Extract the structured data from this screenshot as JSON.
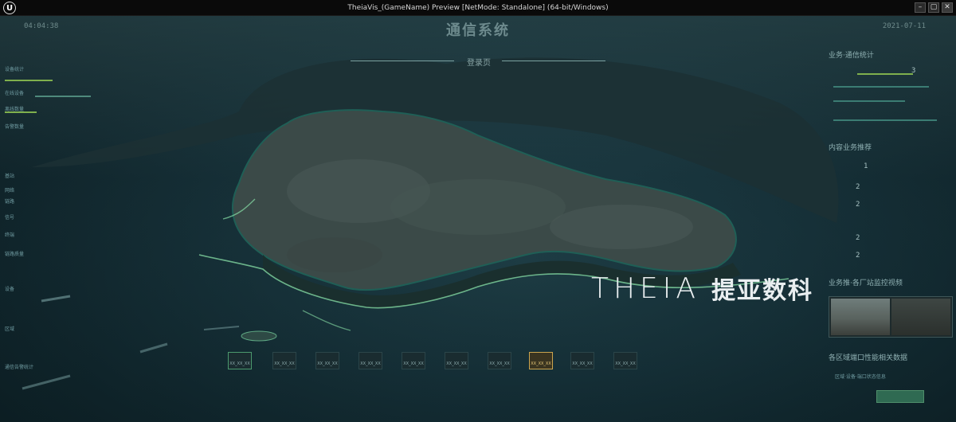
{
  "window": {
    "title": "TheiaVis_(GameName) Preview [NetMode: Standalone] (64-bit/Windows)",
    "logo_glyph": "U",
    "minimize_glyph": "–",
    "maximize_glyph": "▢",
    "close_glyph": "✕"
  },
  "header": {
    "time": "04:04:38",
    "title": "通信系统",
    "date": "2021-07-11",
    "subtab": "登录页"
  },
  "left_panel": {
    "rows": [
      "设备统计",
      "在线设备",
      "离线数量",
      "告警数量",
      "基站",
      "网络",
      "链路",
      "信号",
      "终端",
      "链路质量",
      "设备",
      "区域",
      "通信告警统计"
    ]
  },
  "right_panel": {
    "section1_title": "业务·通信统计",
    "section1_value": "3",
    "section2_title": "内容业务推荐",
    "section2_value_top": "1",
    "section2_values": [
      "2",
      "2",
      "2",
      "2"
    ],
    "section3_title": "业务推·各厂站监控视频",
    "section4_title": "各区域端口性能相关数据",
    "section4_detail": "区域·设备·端口状态信息"
  },
  "bottom_buttons": [
    "XX_XX_XX",
    "XX_XX_XX",
    "XX_XX_XX",
    "XX_XX_XX",
    "XX_XX_XX",
    "XX_XX_XX",
    "XX_XX_XX",
    "XX_XX_XX",
    "XX_XX_XX",
    "XX_XX_XX"
  ],
  "bottom_active_index": 7,
  "watermark": {
    "logo": "THEIA",
    "brand": "提亚数科"
  },
  "colors": {
    "sea": "#17323a",
    "land": "#3b4a48",
    "land_edge": "#1f5f56",
    "coast_glow": "#88e0a7",
    "active_button": "#caa44f"
  }
}
